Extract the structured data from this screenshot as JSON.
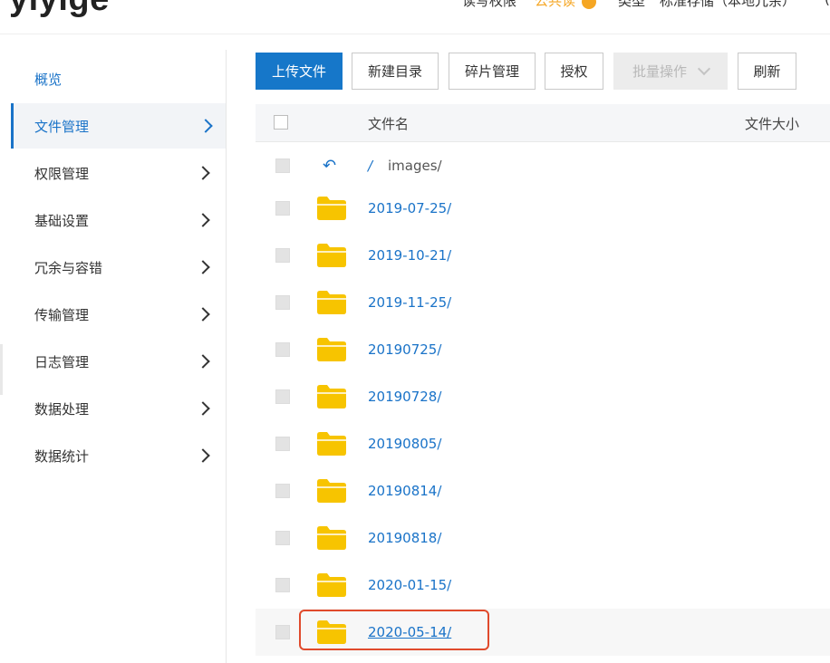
{
  "header": {
    "brand": "yiyige",
    "label1": "读写权限",
    "value1": "公共读",
    "label2": "类型",
    "value2": "标准存储（本地冗余）",
    "edge": "("
  },
  "sidebar": {
    "items": [
      {
        "label": "概览"
      },
      {
        "label": "文件管理"
      },
      {
        "label": "权限管理"
      },
      {
        "label": "基础设置"
      },
      {
        "label": "冗余与容错"
      },
      {
        "label": "传输管理"
      },
      {
        "label": "日志管理"
      },
      {
        "label": "数据处理"
      },
      {
        "label": "数据统计"
      }
    ]
  },
  "toolbar": {
    "upload": "上传文件",
    "new_dir": "新建目录",
    "fragments": "碎片管理",
    "authorize": "授权",
    "batch": "批量操作",
    "refresh": "刷新"
  },
  "table": {
    "col_name": "文件名",
    "col_size": "文件大小",
    "path_sep": "/",
    "path_current": "images/",
    "folders": [
      "2019-07-25/",
      "2019-10-21/",
      "2019-11-25/",
      "20190725/",
      "20190728/",
      "20190805/",
      "20190814/",
      "20190818/",
      "2020-01-15/",
      "2020-05-14/"
    ]
  },
  "colors": {
    "accent": "#1677c9",
    "link": "#1a73c8",
    "folder": "#f7c400",
    "highlight": "#e04a2c"
  },
  "icons": {
    "folder": "folder-icon",
    "back": "back-arrow-icon",
    "chevron": "chevron-right-icon"
  }
}
